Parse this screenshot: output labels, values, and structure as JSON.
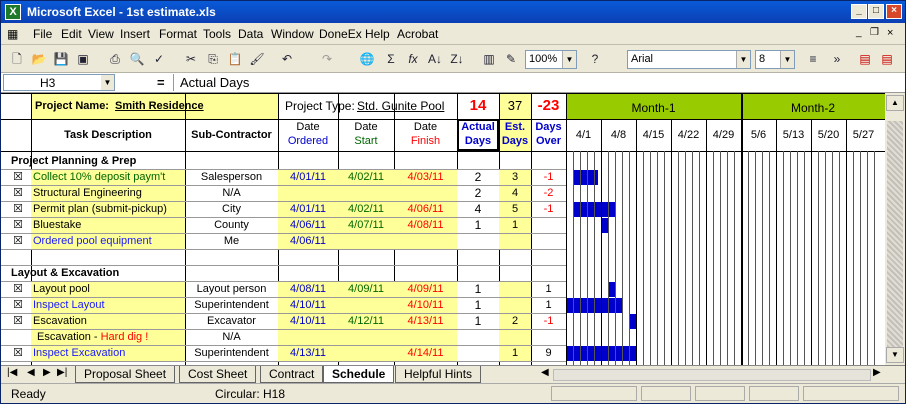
{
  "window": {
    "title": "Microsoft Excel - 1st estimate.xls"
  },
  "menu": [
    "File",
    "Edit",
    "View",
    "Insert",
    "Format",
    "Tools",
    "Data",
    "Window",
    "DoneEx",
    "Help",
    "Acrobat"
  ],
  "toolbar": {
    "zoom": "100%",
    "font": "Arial",
    "font_size": "8"
  },
  "formula": {
    "cell_ref": "H3",
    "eq": "=",
    "content": "Actual Days"
  },
  "header": {
    "project_name_label": "Project Name:",
    "project_name_value": "Smith Residence",
    "project_type_label": "Project Type:",
    "project_type_value": "Std. Gunite Pool",
    "total_actual": "14",
    "total_est": "37",
    "total_over": "-23",
    "month1": "Month-1",
    "month2": "Month-2",
    "col_task": "Task Description",
    "col_sub": "Sub-Contractor",
    "col_ordered_1": "Date",
    "col_ordered_2": "Ordered",
    "col_start_1": "Date",
    "col_start_2": "Start",
    "col_finish_1": "Date",
    "col_finish_2": "Finish",
    "col_actual_1": "Actual",
    "col_actual_2": "Days",
    "col_est_1": "Est.",
    "col_est_2": "Days",
    "col_over_1": "Days",
    "col_over_2": "Over",
    "weeks": [
      "4/1",
      "4/8",
      "4/15",
      "4/22",
      "4/29",
      "5/6",
      "5/13",
      "5/20",
      "5/27"
    ]
  },
  "rows": [
    {
      "type": "section",
      "task": "Project Planning & Prep"
    },
    {
      "type": "task",
      "chk": "☒",
      "task": "Collect 10% deposit paym't",
      "task_color": "#006600",
      "sub": "Salesperson",
      "ordered": "4/01/11",
      "start": "4/02/11",
      "finish": "4/03/11",
      "actual": "2",
      "est": "3",
      "over": "-1",
      "gantt": [
        [
          0.2,
          0.9
        ]
      ]
    },
    {
      "type": "task",
      "chk": "☒",
      "task": "Structural Engineering",
      "task_color": "#000000",
      "sub": "N/A",
      "ordered": "",
      "start": "",
      "finish": "",
      "actual": "2",
      "est": "4",
      "over": "-2",
      "gantt": []
    },
    {
      "type": "task",
      "chk": "☒",
      "task": "Permit plan (submit-pickup)",
      "task_color": "#000000",
      "sub": "City",
      "ordered": "4/01/11",
      "start": "4/02/11",
      "finish": "4/06/11",
      "actual": "4",
      "est": "5",
      "over": "-1",
      "gantt": [
        [
          0.2,
          1.4
        ]
      ]
    },
    {
      "type": "task",
      "chk": "☒",
      "task": "Bluestake",
      "task_color": "#000000",
      "sub": "County",
      "ordered": "4/06/11",
      "start": "4/07/11",
      "finish": "4/08/11",
      "actual": "1",
      "est": "1",
      "over": "",
      "gantt": [
        [
          1.0,
          1.2
        ]
      ]
    },
    {
      "type": "task",
      "chk": "☒",
      "task": "Ordered pool equipment",
      "task_color": "#1a1aff",
      "sub": "Me",
      "ordered": "4/06/11",
      "start": "",
      "finish": "",
      "actual": "",
      "est": "",
      "over": "",
      "gantt": []
    },
    {
      "type": "blank"
    },
    {
      "type": "section",
      "task": "Layout & Excavation"
    },
    {
      "type": "task",
      "chk": "☒",
      "task": "Layout pool",
      "task_color": "#000000",
      "sub": "Layout person",
      "ordered": "4/08/11",
      "start": "4/09/11",
      "finish": "4/09/11",
      "actual": "1",
      "est": "",
      "over": "1",
      "gantt": [
        [
          1.2,
          1.4
        ]
      ]
    },
    {
      "type": "task",
      "chk": "☒",
      "task": "Inspect Layout",
      "task_color": "#1a1aff",
      "sub": "Superintendent",
      "ordered": "4/10/11",
      "start": "",
      "finish": "4/10/11",
      "actual": "1",
      "est": "",
      "over": "1",
      "gantt": [
        [
          0.0,
          1.6
        ]
      ]
    },
    {
      "type": "task",
      "chk": "☒",
      "task": "Escavation",
      "task_color": "#000000",
      "sub": "Excavator",
      "ordered": "4/10/11",
      "start": "4/12/11",
      "finish": "4/13/11",
      "actual": "1",
      "est": "2",
      "over": "-1",
      "gantt": [
        [
          1.8,
          2.0
        ]
      ]
    },
    {
      "type": "task",
      "chk": "",
      "task": "Escavation - ",
      "task_extra": "Hard dig !",
      "task_color": "#000000",
      "sub": "N/A",
      "ordered": "",
      "start": "",
      "finish": "",
      "actual": "",
      "est": "",
      "over": "",
      "gantt": []
    },
    {
      "type": "task",
      "chk": "☒",
      "task": "Inspect Excavation",
      "task_color": "#1a1aff",
      "sub": "Superintendent",
      "ordered": "4/13/11",
      "start": "",
      "finish": "4/14/11",
      "actual": "",
      "est": "1",
      "over": "9",
      "gantt": [
        [
          0.0,
          2.0
        ]
      ]
    }
  ],
  "tabs": [
    "Proposal Sheet",
    "Cost Sheet",
    "Contract",
    "Schedule",
    "Helpful Hints"
  ],
  "active_tab": "Schedule",
  "status": {
    "ready": "Ready",
    "circular": "Circular: H18"
  },
  "colors": {
    "gantt_bar": "#0000cc",
    "month_bg": "#99cc00",
    "yellow": "#ffff99",
    "red": "#ff0000",
    "blue": "#0000cc",
    "green": "#006600"
  }
}
